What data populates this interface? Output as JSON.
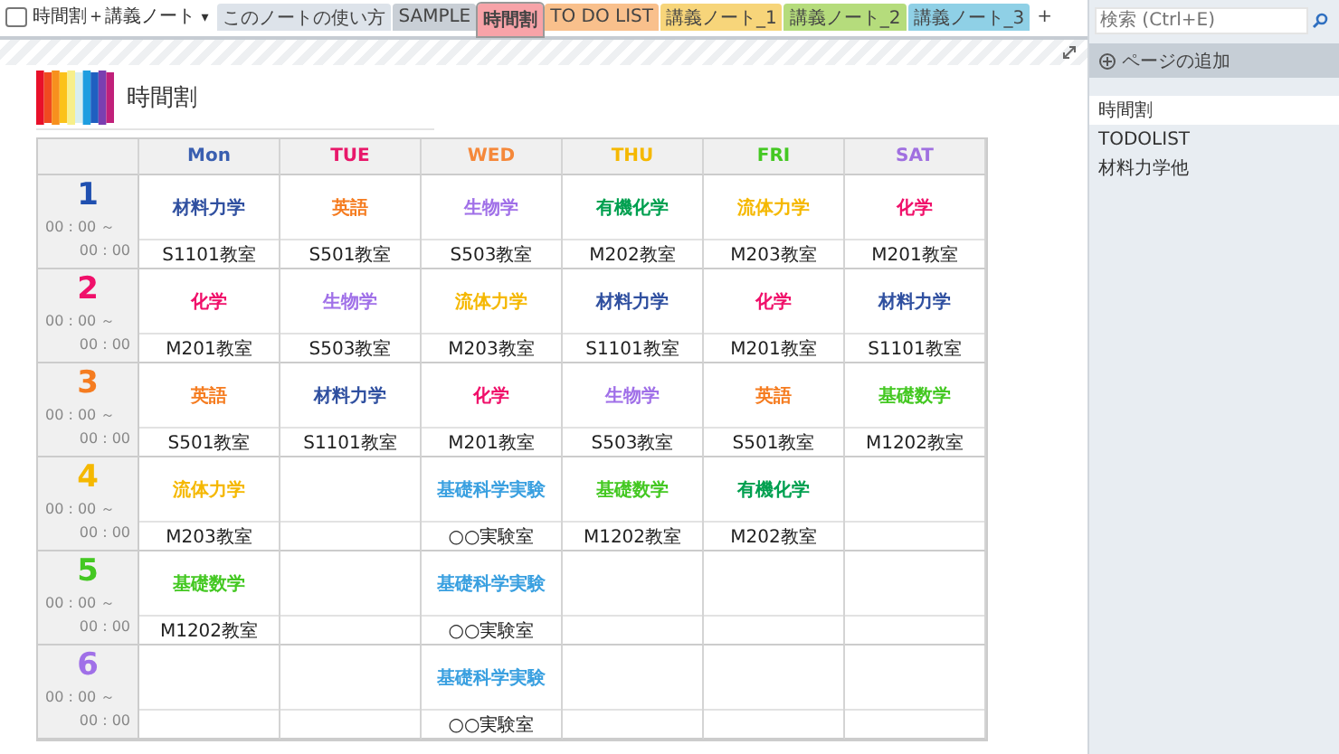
{
  "notebook": {
    "title": "時間割＋講義ノート",
    "caret": "▾"
  },
  "tabs": [
    {
      "label": "このノートの使い方",
      "color": "#dde3ea",
      "selected": false
    },
    {
      "label": "SAMPLE",
      "color": "#c9cfd6",
      "selected": false
    },
    {
      "label": "時間割",
      "color": "#f7a3a8",
      "selected": true
    },
    {
      "label": "TO DO LIST",
      "color": "#f9c08c",
      "selected": false
    },
    {
      "label": "講義ノート_1",
      "color": "#f7d57a",
      "selected": false
    },
    {
      "label": "講義ノート_2",
      "color": "#b5dc7c",
      "selected": false
    },
    {
      "label": "講義ノート_3",
      "color": "#8fd0e6",
      "selected": false
    },
    {
      "label": "+",
      "color": "#ffffff",
      "selected": false
    }
  ],
  "search": {
    "placeholder": "検索 (Ctrl+E)"
  },
  "page": {
    "title": "時間割"
  },
  "table": {
    "columns": [
      {
        "label": "Mon",
        "color": "#3a5fb0"
      },
      {
        "label": "TUE",
        "color": "#e8186a"
      },
      {
        "label": "WED",
        "color": "#f5883a"
      },
      {
        "label": "THU",
        "color": "#f5b800"
      },
      {
        "label": "FRI",
        "color": "#44c822"
      },
      {
        "label": "SAT",
        "color": "#a070e0"
      }
    ],
    "rows": [
      {
        "period": "1",
        "color": "#2050b0",
        "start": "00 : 00 ～",
        "end": "00 : 00",
        "cells": [
          {
            "subject": "材料力学",
            "color": "#3050a0",
            "room": "S1101教室"
          },
          {
            "subject": "英語",
            "color": "#f57c20",
            "room": "S501教室"
          },
          {
            "subject": "生物学",
            "color": "#a070e8",
            "room": "S503教室"
          },
          {
            "subject": "有機化学",
            "color": "#00a050",
            "room": "M202教室"
          },
          {
            "subject": "流体力学",
            "color": "#f5b800",
            "room": "M203教室"
          },
          {
            "subject": "化学",
            "color": "#f0106a",
            "room": "M201教室"
          }
        ]
      },
      {
        "period": "2",
        "color": "#f0106a",
        "start": "00 : 00 ～",
        "end": "00 : 00",
        "cells": [
          {
            "subject": "化学",
            "color": "#f0106a",
            "room": "M201教室"
          },
          {
            "subject": "生物学",
            "color": "#a070e8",
            "room": "S503教室"
          },
          {
            "subject": "流体力学",
            "color": "#f5b800",
            "room": "M203教室"
          },
          {
            "subject": "材料力学",
            "color": "#3050a0",
            "room": "S1101教室"
          },
          {
            "subject": "化学",
            "color": "#f0106a",
            "room": "M201教室"
          },
          {
            "subject": "材料力学",
            "color": "#3050a0",
            "room": "S1101教室"
          }
        ]
      },
      {
        "period": "3",
        "color": "#f57c20",
        "start": "00 : 00 ～",
        "end": "00 : 00",
        "cells": [
          {
            "subject": "英語",
            "color": "#f57c20",
            "room": "S501教室"
          },
          {
            "subject": "材料力学",
            "color": "#3050a0",
            "room": "S1101教室"
          },
          {
            "subject": "化学",
            "color": "#f0106a",
            "room": "M201教室"
          },
          {
            "subject": "生物学",
            "color": "#a070e8",
            "room": "S503教室"
          },
          {
            "subject": "英語",
            "color": "#f57c20",
            "room": "S501教室"
          },
          {
            "subject": "基礎数学",
            "color": "#44c822",
            "room": "M1202教室"
          }
        ]
      },
      {
        "period": "4",
        "color": "#f5b800",
        "start": "00 : 00 ～",
        "end": "00 : 00",
        "cells": [
          {
            "subject": "流体力学",
            "color": "#f5b800",
            "room": "M203教室"
          },
          null,
          {
            "subject": "基礎科学実験",
            "color": "#3aa0e0",
            "room": "○○実験室"
          },
          {
            "subject": "基礎数学",
            "color": "#44c822",
            "room": "M1202教室"
          },
          {
            "subject": "有機化学",
            "color": "#00a050",
            "room": "M202教室"
          },
          null
        ]
      },
      {
        "period": "5",
        "color": "#44c822",
        "start": "00 : 00 ～",
        "end": "00 : 00",
        "cells": [
          {
            "subject": "基礎数学",
            "color": "#44c822",
            "room": "M1202教室"
          },
          null,
          {
            "subject": "基礎科学実験",
            "color": "#3aa0e0",
            "room": "○○実験室"
          },
          null,
          null,
          null
        ]
      },
      {
        "period": "6",
        "color": "#a070e8",
        "start": "00 : 00 ～",
        "end": "00 : 00",
        "cells": [
          null,
          null,
          {
            "subject": "基礎科学実験",
            "color": "#3aa0e0",
            "room": "○○実験室"
          },
          null,
          null,
          null
        ]
      }
    ]
  },
  "sidebar": {
    "add_page": "ページの追加",
    "items": [
      {
        "label": "時間割",
        "selected": true
      },
      {
        "label": "TODOLIST",
        "selected": false
      },
      {
        "label": "材料力学他",
        "selected": false
      }
    ]
  }
}
